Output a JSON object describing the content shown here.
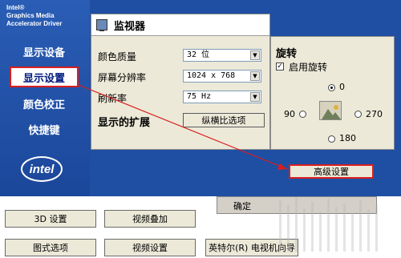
{
  "brand": [
    "Intel®",
    "Graphics Media",
    "Accelerator Driver"
  ],
  "nav": [
    "显示设备",
    "显示设置",
    "颜色校正",
    "快捷键"
  ],
  "logo_text": "intel",
  "monitor": {
    "title": "监视器",
    "color_quality_label": "颜色质量",
    "color_quality_value": "32 位",
    "resolution_label": "屏幕分辨率",
    "resolution_value": "1024 x 768",
    "refresh_label": "刷新率",
    "refresh_value": "75 Hz",
    "extended_label": "显示的扩展",
    "aspect_button": "纵横比选项"
  },
  "rotation": {
    "title": "旋转",
    "enable_label": "启用旋转",
    "enabled": true,
    "options": [
      "0",
      "90",
      "270",
      "180"
    ],
    "selected": "0",
    "advanced_button": "高级设置"
  },
  "bottom_buttons": [
    "3D 设置",
    "视频叠加",
    "图式选项",
    "视频设置",
    "英特尔(R) 电视机向导"
  ],
  "ok_label": "确定",
  "colors": {
    "frame": "#1f4fa3",
    "annotation": "#d91e1e"
  }
}
